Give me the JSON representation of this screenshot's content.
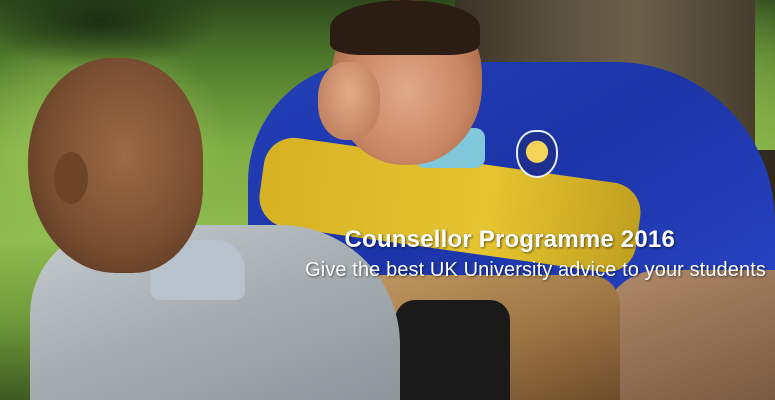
{
  "banner": {
    "title": "Counsellor Programme 2016",
    "subtitle": "Give the best UK University advice to your students"
  }
}
